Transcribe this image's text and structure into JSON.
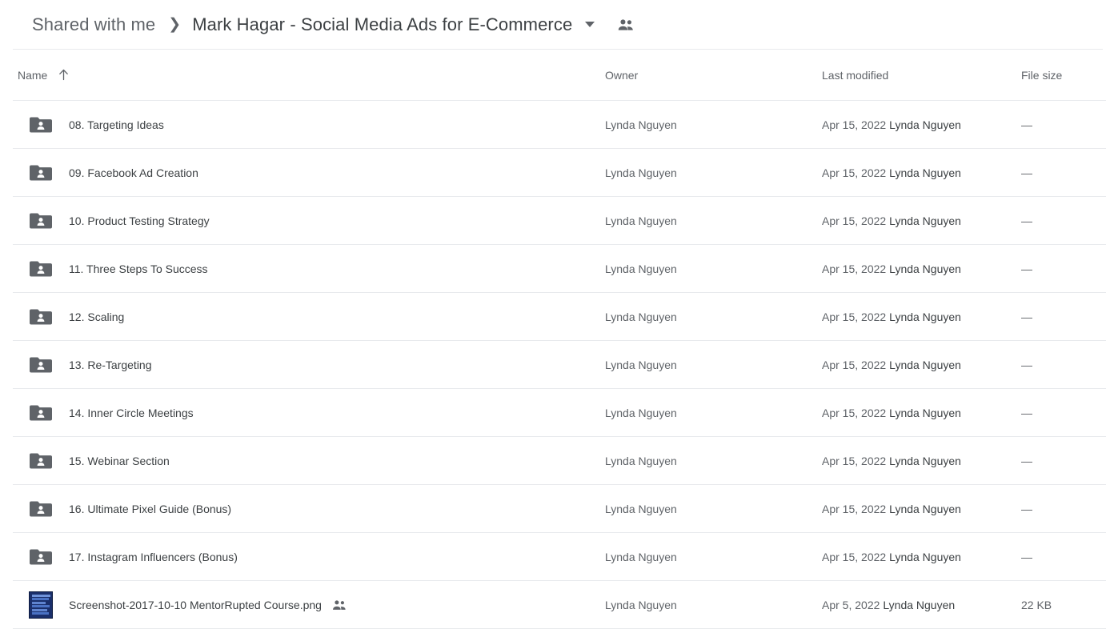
{
  "breadcrumb": {
    "root_label": "Shared with me",
    "separator": "❯",
    "current_label": "Mark Hagar - Social Media Ads for E-Commerce",
    "caret_icon": "chevron-down-icon",
    "share_icon": "people-shared-icon"
  },
  "columns": {
    "name": "Name",
    "sort_icon": "arrow-up-icon",
    "owner": "Owner",
    "last_modified": "Last modified",
    "file_size": "File size"
  },
  "colors": {
    "text_primary": "#3c4043",
    "text_secondary": "#5f6368",
    "divider": "#e8eaed",
    "folder_icon": "#5f6368",
    "thumbnail_blue": "#1a2f6b"
  },
  "rows": [
    {
      "icon": "shared-folder-icon",
      "name": "08. Targeting Ideas",
      "shared": false,
      "owner": "Lynda Nguyen",
      "modified_date": "Apr 15, 2022",
      "modified_by": "Lynda Nguyen",
      "size": "—"
    },
    {
      "icon": "shared-folder-icon",
      "name": "09. Facebook Ad Creation",
      "shared": false,
      "owner": "Lynda Nguyen",
      "modified_date": "Apr 15, 2022",
      "modified_by": "Lynda Nguyen",
      "size": "—"
    },
    {
      "icon": "shared-folder-icon",
      "name": "10. Product Testing Strategy",
      "shared": false,
      "owner": "Lynda Nguyen",
      "modified_date": "Apr 15, 2022",
      "modified_by": "Lynda Nguyen",
      "size": "—"
    },
    {
      "icon": "shared-folder-icon",
      "name": "11. Three Steps To Success",
      "shared": false,
      "owner": "Lynda Nguyen",
      "modified_date": "Apr 15, 2022",
      "modified_by": "Lynda Nguyen",
      "size": "—"
    },
    {
      "icon": "shared-folder-icon",
      "name": "12. Scaling",
      "shared": false,
      "owner": "Lynda Nguyen",
      "modified_date": "Apr 15, 2022",
      "modified_by": "Lynda Nguyen",
      "size": "—"
    },
    {
      "icon": "shared-folder-icon",
      "name": "13. Re-Targeting",
      "shared": false,
      "owner": "Lynda Nguyen",
      "modified_date": "Apr 15, 2022",
      "modified_by": "Lynda Nguyen",
      "size": "—"
    },
    {
      "icon": "shared-folder-icon",
      "name": "14. Inner Circle Meetings",
      "shared": false,
      "owner": "Lynda Nguyen",
      "modified_date": "Apr 15, 2022",
      "modified_by": "Lynda Nguyen",
      "size": "—"
    },
    {
      "icon": "shared-folder-icon",
      "name": "15. Webinar Section",
      "shared": false,
      "owner": "Lynda Nguyen",
      "modified_date": "Apr 15, 2022",
      "modified_by": "Lynda Nguyen",
      "size": "—"
    },
    {
      "icon": "shared-folder-icon",
      "name": "16. Ultimate Pixel Guide (Bonus)",
      "shared": false,
      "owner": "Lynda Nguyen",
      "modified_date": "Apr 15, 2022",
      "modified_by": "Lynda Nguyen",
      "size": "—"
    },
    {
      "icon": "shared-folder-icon",
      "name": "17. Instagram Influencers (Bonus)",
      "shared": false,
      "owner": "Lynda Nguyen",
      "modified_date": "Apr 15, 2022",
      "modified_by": "Lynda Nguyen",
      "size": "—"
    },
    {
      "icon": "png-thumbnail",
      "name": "Screenshot-2017-10-10 MentorRupted Course.png",
      "shared": true,
      "owner": "Lynda Nguyen",
      "modified_date": "Apr 5, 2022",
      "modified_by": "Lynda Nguyen",
      "size": "22 KB"
    }
  ]
}
